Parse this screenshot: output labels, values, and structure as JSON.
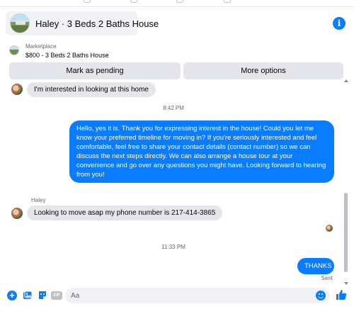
{
  "header": {
    "title": "Haley · 3 Beds 2 Baths House",
    "info_icon": "info-icon",
    "info_glyph": "i"
  },
  "listing": {
    "source": "Marketplace",
    "price_title": "$800 - 3 Beds 2 Baths House"
  },
  "actions": {
    "mark_pending": "Mark as pending",
    "more_options": "More options"
  },
  "thread": {
    "messages": [
      {
        "from": "Haley",
        "text": "I'm interested in looking at this home"
      },
      {
        "timestamp": "8:42 PM"
      },
      {
        "from": "me",
        "text": "Hello, yes it is. Thank you for expressing interest in the house! Could you let me know your preferred timeline for moving in? If you're seriously interested and feel comfortable, feel free to share your contact details (contact number) so we can discuss the next steps directly. We can also arrange a house tour at your convenience and go over any questions you might have. Looking forward to hearing from you!"
      },
      {
        "sender_name": "Haley"
      },
      {
        "from": "Haley",
        "text": "Looking to move asap my phone number is 217-414-3865"
      },
      {
        "timestamp": "11:33 PM"
      },
      {
        "from": "me",
        "text": "THANKS",
        "status": "Sent"
      }
    ]
  },
  "composer": {
    "placeholder": "Aa",
    "plus_glyph": "+",
    "gif_label": "GIF",
    "icons": [
      "plus-icon",
      "image-icon",
      "sticker-icon",
      "gif-icon",
      "emoji-icon",
      "thumbs-up-icon"
    ]
  },
  "colors": {
    "accent": "#0a7cff",
    "incoming_bubble": "#e4e6eb",
    "secondary_text": "#65676b"
  }
}
